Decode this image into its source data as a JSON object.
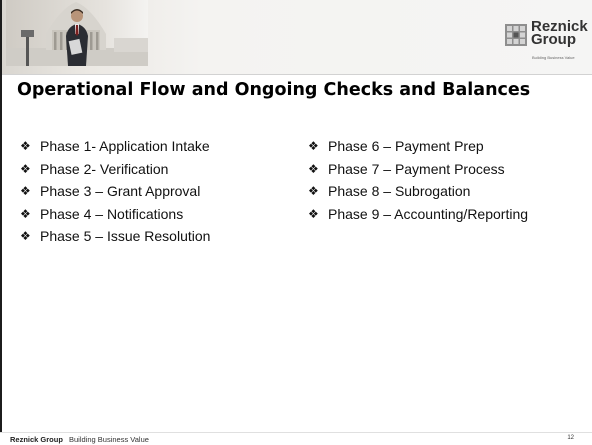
{
  "header": {
    "logo_name_line1": "Reznick",
    "logo_name_line2": "Group",
    "logo_tagline": "Building Business Value"
  },
  "slide": {
    "title": "Operational Flow and Ongoing Checks and Balances",
    "bullet_glyph": "❖",
    "left_items": [
      "Phase 1- Application Intake",
      "Phase 2- Verification",
      "Phase 3 – Grant Approval",
      "Phase 4 – Notifications",
      "Phase 5 – Issue Resolution"
    ],
    "right_items": [
      "Phase 6 – Payment Prep",
      "Phase 7 – Payment Process",
      "Phase 8 – Subrogation",
      "Phase 9 – Accounting/Reporting"
    ]
  },
  "footer": {
    "brand": "Reznick Group",
    "tagline": "Building Business Value",
    "page_number": "12"
  }
}
